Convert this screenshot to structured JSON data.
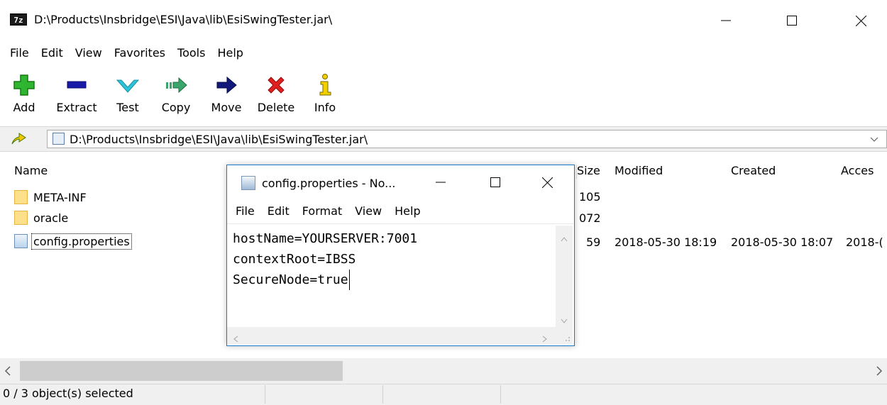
{
  "window": {
    "title": "D:\\Products\\Insbridge\\ESI\\Java\\lib\\EsiSwingTester.jar\\",
    "icon_label": "7z"
  },
  "menu": [
    {
      "label": "File"
    },
    {
      "label": "Edit"
    },
    {
      "label": "View"
    },
    {
      "label": "Favorites"
    },
    {
      "label": "Tools"
    },
    {
      "label": "Help"
    }
  ],
  "toolbar": [
    {
      "label": "Add",
      "icon": "plus-icon",
      "color": "#2fb52f"
    },
    {
      "label": "Extract",
      "icon": "minus-icon",
      "color": "#1a1aa8"
    },
    {
      "label": "Test",
      "icon": "check-icon",
      "color": "#2cc4d9"
    },
    {
      "label": "Copy",
      "icon": "copy-arrow-icon",
      "color": "#3aa66b"
    },
    {
      "label": "Move",
      "icon": "move-arrow-icon",
      "color": "#111a7a"
    },
    {
      "label": "Delete",
      "icon": "delete-x-icon",
      "color": "#e02020"
    },
    {
      "label": "Info",
      "icon": "info-icon",
      "color": "#c9a400"
    }
  ],
  "address": {
    "path": "D:\\Products\\Insbridge\\ESI\\Java\\lib\\EsiSwingTester.jar\\"
  },
  "columns": {
    "name": "Name",
    "size": "Size",
    "modified": "Modified",
    "created": "Created",
    "accessed": "Acces"
  },
  "rows": [
    {
      "name": "META-INF",
      "size": "105",
      "modified": "",
      "created": "",
      "accessed": "",
      "type": "folder"
    },
    {
      "name": "oracle",
      "size": "072",
      "modified": "",
      "created": "",
      "accessed": "",
      "type": "folder"
    },
    {
      "name": "config.properties",
      "size": "59",
      "modified": "2018-05-30 18:19",
      "created": "2018-05-30 18:07",
      "accessed": "2018-(",
      "type": "file"
    }
  ],
  "status": {
    "selection": "0 / 3 object(s) selected"
  },
  "notepad": {
    "title": "config.properties - No...",
    "menu": [
      {
        "label": "File"
      },
      {
        "label": "Edit"
      },
      {
        "label": "Format"
      },
      {
        "label": "View"
      },
      {
        "label": "Help"
      }
    ],
    "lines": [
      "hostName=YOURSERVER:7001",
      "contextRoot=IBSS",
      "SecureNode=true"
    ]
  }
}
